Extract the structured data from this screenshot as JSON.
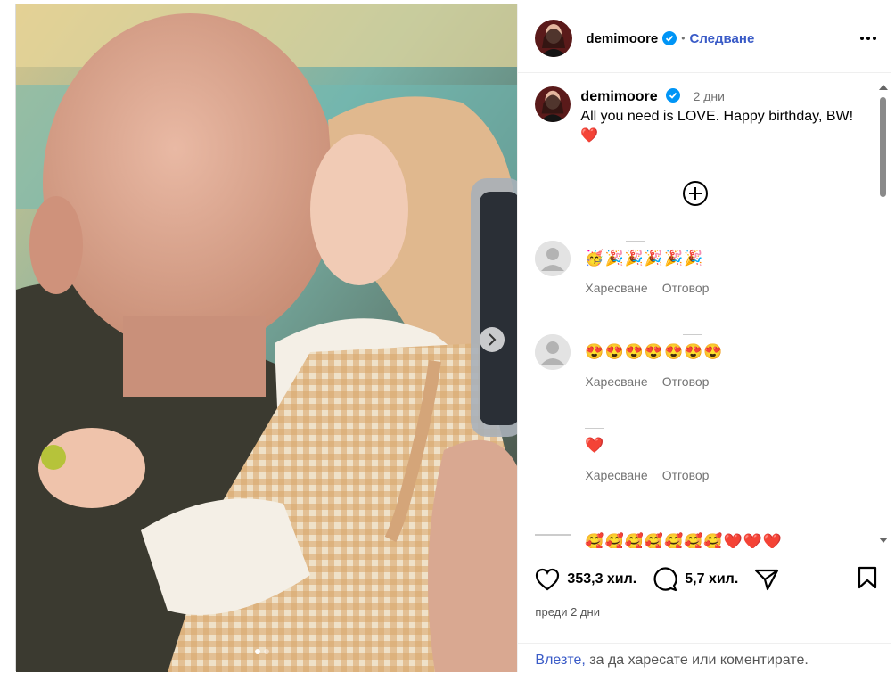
{
  "post": {
    "username": "demimoore",
    "separator": "•",
    "follow_label": "Следване",
    "photo_dots": 2
  },
  "caption": {
    "username": "demimoore",
    "time": "2 дни",
    "text": "All you need is LOVE. Happy birthday, BW! ❤️"
  },
  "comments": [
    {
      "emojis": "🥳🎉🎉🎉🎉🎉",
      "like_label": "Харесване",
      "reply_label": "Отговор",
      "has_avatar": true
    },
    {
      "emojis": "😍😍😍😍😍😍😍",
      "like_label": "Харесване",
      "reply_label": "Отговор",
      "has_avatar": true
    },
    {
      "emojis": "❤️",
      "like_label": "Харесване",
      "reply_label": "Отговор",
      "has_avatar": false
    },
    {
      "emojis": "🥰🥰🥰🥰🥰🥰🥰❤️❤️❤️",
      "like_label": "",
      "reply_label": "",
      "has_avatar": false
    }
  ],
  "stats": {
    "likes": "353,3 хил.",
    "comments": "5,7 хил.",
    "posted_ago": "преди 2 дни"
  },
  "login_prompt": {
    "link": "Влезте,",
    "text": " за да харесате или коментирате."
  },
  "colors": {
    "link_blue": "#3a5bc7",
    "verified_blue": "#0095f6",
    "heart_red": "#ed1c24",
    "muted_gray": "#737373"
  },
  "icons": [
    "verified-badge-icon",
    "more-options-icon",
    "add-comment-icon",
    "heart-icon",
    "comment-icon",
    "share-icon",
    "bookmark-icon",
    "chevron-right-icon"
  ]
}
